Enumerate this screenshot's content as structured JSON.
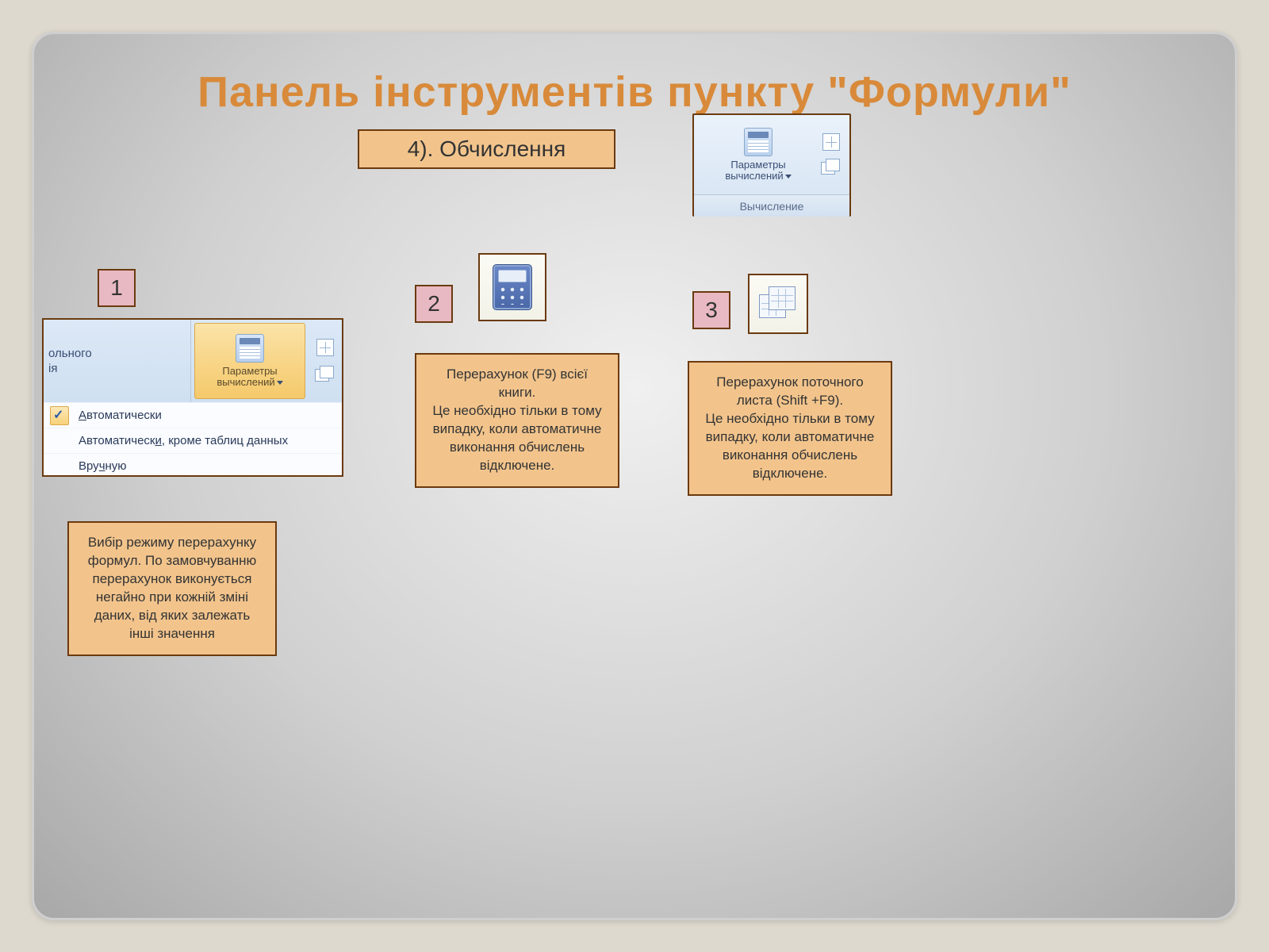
{
  "title": "Панель інструментів пункту \"Формули\"",
  "subtitle": "4). Обчислення",
  "ribbon": {
    "button_label": "Параметры вычислений",
    "group_name": "Вычисление"
  },
  "badges": {
    "n1": "1",
    "n2": "2",
    "n3": "3"
  },
  "menu_panel": {
    "left_line1": "ольного",
    "left_line2": "ія",
    "center_label": "Параметры вычислений",
    "items": [
      {
        "label_pre": "А",
        "label_rest": "втоматически",
        "checked": true
      },
      {
        "label_pre": "Автоматическ",
        "label_u": "и",
        "label_post": ", кроме таблиц данных",
        "checked": false
      },
      {
        "label_pre": "Вру",
        "label_u": "ч",
        "label_post": "ную",
        "checked": false
      }
    ]
  },
  "desc1": "Вибір режиму перерахунку формул. По замовчуванню перерахунок виконується негайно при кожній зміні даних, від яких залежать інші значення",
  "desc2": "Перерахунок (F9) всієї книги.\nЦе необхідно тільки в тому випадку, коли автоматичне виконання обчислень відключене.",
  "desc3": "Перерахунок поточного листа (Shift +F9).\nЦе необхідно тільки в тому випадку, коли автоматичне виконання обчислень відключене."
}
